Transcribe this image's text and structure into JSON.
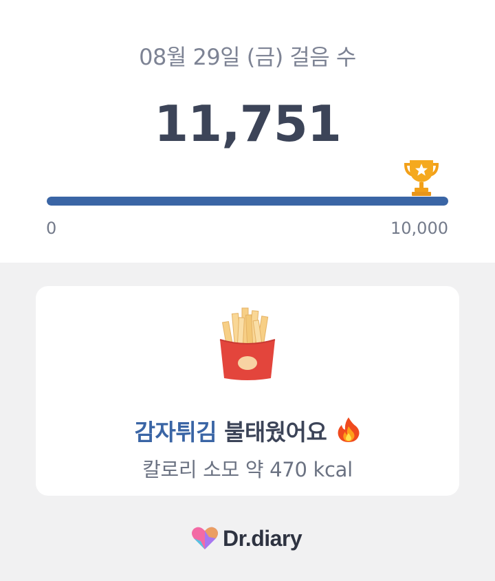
{
  "header": {
    "title": "08월 29일 (금) 걸음 수"
  },
  "steps": {
    "count": "11,751",
    "progress_fraction": 1.0,
    "goal_icon": "trophy-icon",
    "axis_min": "0",
    "axis_max": "10,000"
  },
  "burn_card": {
    "food_icon": "french-fries-icon",
    "food_name": "감자튀김",
    "burn_text": "불태웠어요",
    "flame_icon": "fire-icon",
    "calorie_text": "칼로리 소모 약 470 kcal"
  },
  "footer": {
    "brand_name": "Dr.diary",
    "logo_icon": "heart-logo-icon"
  },
  "colors": {
    "accent": "#3a65a5",
    "heading": "#3c4458",
    "muted": "#7d8394",
    "background": "#f1f1f2",
    "card": "#ffffff",
    "trophy": "#f2a019"
  }
}
